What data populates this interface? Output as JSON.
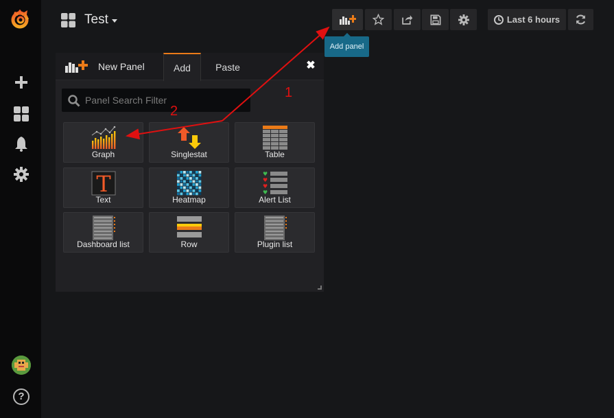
{
  "sidebar": {
    "items": [
      {
        "name": "plus-icon"
      },
      {
        "name": "dashboards-icon"
      },
      {
        "name": "bell-icon"
      },
      {
        "name": "gear-icon"
      }
    ],
    "help_label": "?"
  },
  "topnav": {
    "dashboard_title": "Test",
    "time_range": "Last 6 hours",
    "tooltip": "Add panel"
  },
  "panel": {
    "header_title": "New Panel",
    "tabs": [
      {
        "label": "Add",
        "active": true
      },
      {
        "label": "Paste",
        "active": false
      }
    ],
    "close_label": "✖",
    "search_placeholder": "Panel Search Filter",
    "panel_types": [
      {
        "label": "Graph",
        "icon": "graph-icon"
      },
      {
        "label": "Singlestat",
        "icon": "singlestat-icon"
      },
      {
        "label": "Table",
        "icon": "table-icon"
      },
      {
        "label": "Text",
        "icon": "text-icon"
      },
      {
        "label": "Heatmap",
        "icon": "heatmap-icon"
      },
      {
        "label": "Alert List",
        "icon": "alert-list-icon"
      },
      {
        "label": "Dashboard list",
        "icon": "dashboard-list-icon"
      },
      {
        "label": "Row",
        "icon": "row-icon"
      },
      {
        "label": "Plugin list",
        "icon": "plugin-list-icon"
      }
    ]
  },
  "annotations": {
    "step1": "1",
    "step2": "2",
    "color": "#e01010"
  },
  "colors": {
    "accent": "#eb7b18",
    "tooltip_bg": "#186988",
    "background": "#161719"
  }
}
